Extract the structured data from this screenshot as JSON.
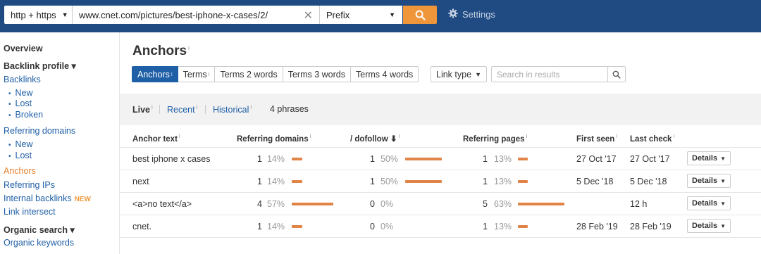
{
  "topbar": {
    "protocol": "http + https",
    "url": "www.cnet.com/pictures/best-iphone-x-cases/2/",
    "mode": "Prefix",
    "settings_label": "Settings"
  },
  "sidebar": {
    "overview": "Overview",
    "backlink_profile": "Backlink profile ▾",
    "backlinks": "Backlinks",
    "bl_new": "New",
    "bl_lost": "Lost",
    "bl_broken": "Broken",
    "referring_domains": "Referring domains",
    "rd_new": "New",
    "rd_lost": "Lost",
    "anchors": "Anchors",
    "referring_ips": "Referring IPs",
    "internal_backlinks": "Internal backlinks",
    "new_badge": "NEW",
    "link_intersect": "Link intersect",
    "organic_search": "Organic search ▾",
    "organic_keywords": "Organic keywords"
  },
  "main": {
    "title": "Anchors",
    "info": "i",
    "tabs": [
      "Anchors",
      "Terms",
      "Terms 2 words",
      "Terms 3 words",
      "Terms 4 words"
    ],
    "link_type": "Link type",
    "search_placeholder": "Search in results",
    "filters": {
      "live": "Live",
      "recent": "Recent",
      "historical": "Historical",
      "count": "4 phrases"
    },
    "columns": [
      "Anchor text",
      "Referring domains",
      "/ dofollow",
      "Referring pages",
      "First seen",
      "Last check"
    ],
    "details_label": "Details",
    "rows": [
      {
        "anchor": "best iphone x cases",
        "rd": "1",
        "rd_pct": "14%",
        "rd_frac": 0.14,
        "df": "1",
        "df_pct": "50%",
        "df_frac": 0.5,
        "rp": "1",
        "rp_pct": "13%",
        "rp_frac": 0.13,
        "first_seen": "27 Oct '17",
        "last_check": "27 Oct '17"
      },
      {
        "anchor": "next",
        "rd": "1",
        "rd_pct": "14%",
        "rd_frac": 0.14,
        "df": "1",
        "df_pct": "50%",
        "df_frac": 0.5,
        "rp": "1",
        "rp_pct": "13%",
        "rp_frac": 0.13,
        "first_seen": "5 Dec '18",
        "last_check": "5 Dec '18"
      },
      {
        "anchor": "<a>no text</a>",
        "rd": "4",
        "rd_pct": "57%",
        "rd_frac": 0.57,
        "df": "0",
        "df_pct": "0%",
        "df_frac": 0,
        "rp": "5",
        "rp_pct": "63%",
        "rp_frac": 0.63,
        "first_seen": "",
        "last_check": "12 h"
      },
      {
        "anchor": "cnet.",
        "rd": "1",
        "rd_pct": "14%",
        "rd_frac": 0.14,
        "df": "0",
        "df_pct": "0%",
        "df_frac": 0,
        "rp": "1",
        "rp_pct": "13%",
        "rp_frac": 0.13,
        "first_seen": "28 Feb '19",
        "last_check": "28 Feb '19"
      }
    ]
  },
  "colors": {
    "topbar": "#1f4a82",
    "accent_orange": "#f0963a",
    "link_blue": "#1f5fa6",
    "active_orange": "#e57e2a",
    "bar": "#e08447"
  }
}
